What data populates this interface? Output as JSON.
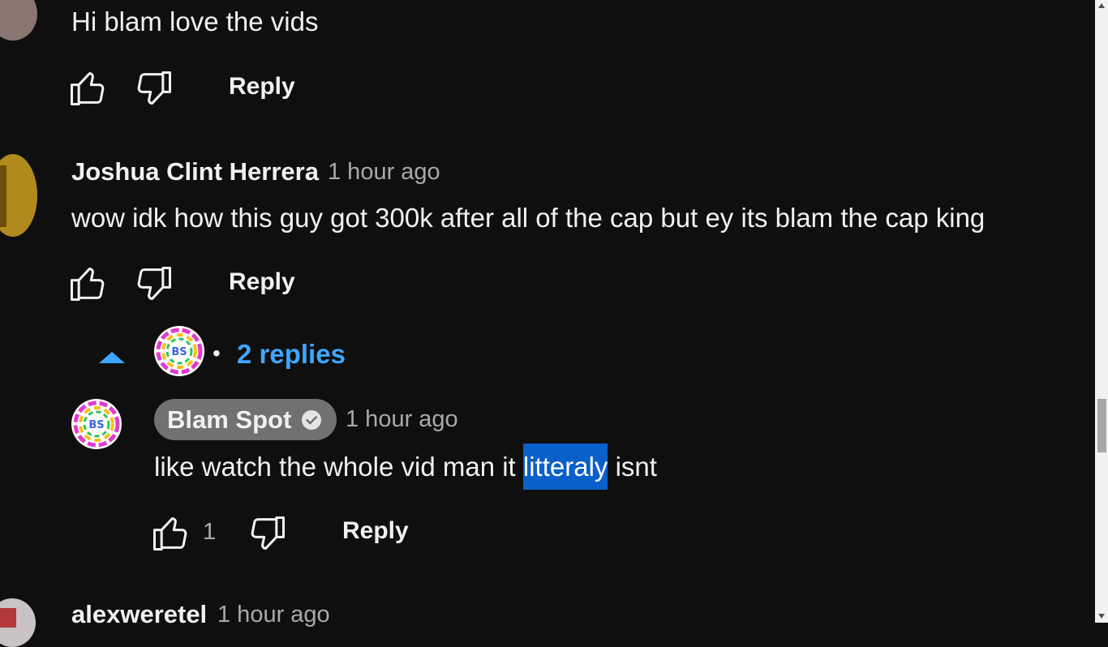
{
  "comments": [
    {
      "text": "Hi blam love the vids",
      "reply_label": "Reply"
    },
    {
      "author": "Joshua Clint Herrera",
      "time": "1 hour ago",
      "text": "wow idk how this guy got 300k after all of the cap but ey its blam the cap king",
      "reply_label": "Reply"
    }
  ],
  "replies_toggle": {
    "separator": "•",
    "label": "2 replies",
    "avatar_text": "BS"
  },
  "reply": {
    "author": "Blam Spot",
    "time": "1 hour ago",
    "text_before": "like watch the whole vid man it ",
    "text_highlight": "litteraly",
    "text_after": " isnt",
    "like_count": "1",
    "reply_label": "Reply",
    "avatar_text": "BS"
  },
  "next_comment": {
    "author": "alexweretel",
    "time": "1 hour ago"
  },
  "colors": {
    "background": "#0f0f0f",
    "link_blue": "#3ea6ff",
    "selection": "#0a5fc8",
    "badge_bg": "#717171"
  },
  "icons": [
    "thumbs-up-icon",
    "thumbs-down-icon",
    "chevron-up-icon",
    "verified-check-icon"
  ]
}
